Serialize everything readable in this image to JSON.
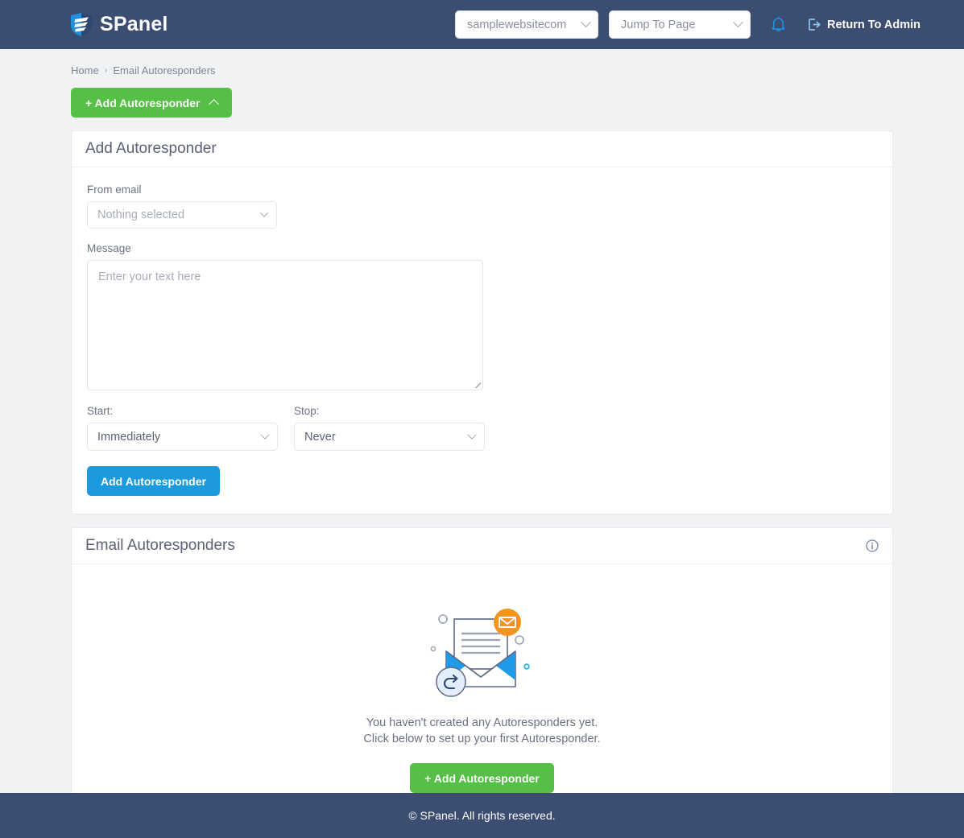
{
  "header": {
    "brand": "SPanel",
    "site_selector": {
      "value": "samplewebsitecom"
    },
    "jump_selector": {
      "value": "Jump To Page"
    },
    "notifications_icon": "bell-icon",
    "admin_link": "Return To Admin"
  },
  "breadcrumb": {
    "home": "Home",
    "separator": "›",
    "current": "Email Autoresponders"
  },
  "toggle_button": {
    "label": "+ Add Autoresponder"
  },
  "form_card": {
    "title": "Add Autoresponder",
    "from_email": {
      "label": "From email",
      "value": "Nothing selected"
    },
    "message": {
      "label": "Message",
      "placeholder": "Enter your text here",
      "value": ""
    },
    "start": {
      "label": "Start:",
      "value": "Immediately"
    },
    "stop": {
      "label": "Stop:",
      "value": "Never"
    },
    "submit": {
      "label": "Add Autoresponder"
    }
  },
  "list_card": {
    "title": "Email Autoresponders",
    "info_icon": "info-icon",
    "empty": {
      "line1": "You haven't created any Autoresponders yet. Click",
      "line2": "below to set up your first Autoresponder.",
      "button": "+ Add Autoresponder"
    }
  },
  "footer": {
    "text": "© SPanel. All rights reserved."
  },
  "colors": {
    "navy": "#3b4d71",
    "green": "#56bf45",
    "blue": "#1b9bdd",
    "orange": "#f59322",
    "page_bg": "#f1f2f4"
  }
}
